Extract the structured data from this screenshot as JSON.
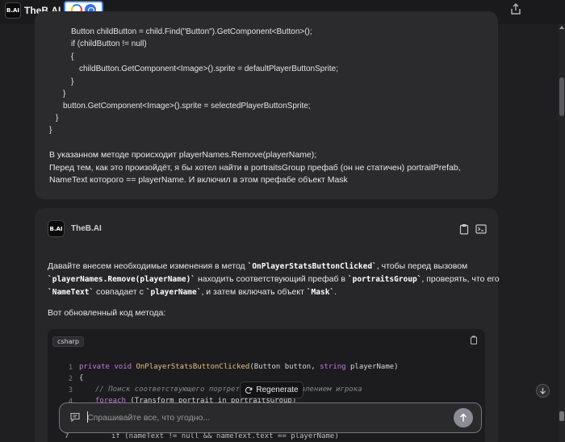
{
  "header": {
    "logo_text": "B.AI",
    "title": "TheB.AI",
    "share_icon": "share-icon"
  },
  "user_message": {
    "code_lines": [
      "Button childButton = child.Find(\"Button\").GetComponent<Button>();",
      "if (childButton != null)",
      "{",
      "childButton.GetComponent<Image>().sprite = defaultPlayerButtonSprite;",
      "}",
      "}",
      "button.GetComponent<Image>().sprite = selectedPlayerButtonSprite;",
      "}",
      "}"
    ],
    "text_lines": [
      "В указанном методе происходит playerNames.Remove(playerName);",
      "Перед тем, как это произойдёт, я бы хотел найти в portraitsGroup префаб (он не статичен) portraitPrefab,",
      "NameText которого == playerName. И включил в этом префабе объект Mask"
    ]
  },
  "assistant": {
    "avatar_text": "B.AI",
    "name": "TheB.AI",
    "p1_a": "Давайте внесем необходимые изменения в метод ",
    "p1_code1": "`OnPlayerStatsButtonClicked`",
    "p1_b": ", чтобы перед вызовом",
    "p2_code1": "`playerNames.Remove(playerName)`",
    "p2_a": " находить соответствующий префаб в ",
    "p2_code2": "`portraitsGroup`",
    "p2_b": ", проверять, что его",
    "p3_code1": "`NameText`",
    "p3_a": " совпадает с ",
    "p3_code2": "`playerName`",
    "p3_b": ", и затем включать объект ",
    "p3_code3": "`Mask`",
    "p3_c": ".",
    "p4": "Вот обновленный код метода:",
    "code": {
      "language": "csharp",
      "line_numbers": [
        "1",
        "2",
        "3",
        "4",
        "5",
        "6",
        "7"
      ],
      "line1": {
        "k1": "private",
        "k2": "void",
        "fn": "OnPlayerStatsButtonClicked",
        "p1": "(Button button, ",
        "ty": "string",
        "p2": " playerName)"
      },
      "line2": "{",
      "line3": "// Поиск соответствующего портрета     перед удалением игрока",
      "line4_kw": "foreach",
      "line4": " (Transform portrait in portraitsGroup)",
      "line7": "if (nameText != null && nameText.text == playerName)"
    }
  },
  "regenerate_label": "Regenerate",
  "chat": {
    "placeholder": "Спрашивайте все, что угодно..."
  }
}
